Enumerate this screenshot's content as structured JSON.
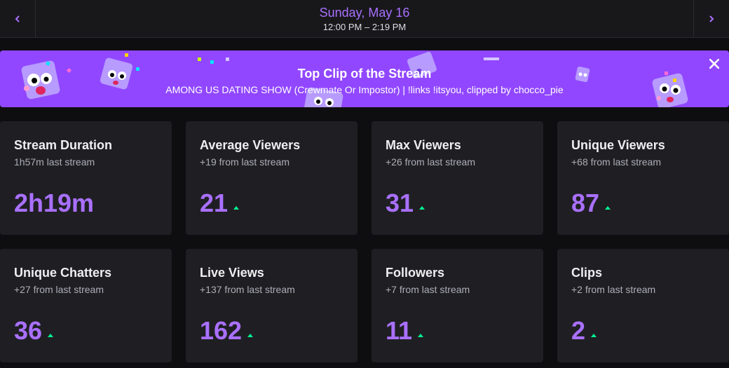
{
  "header": {
    "date": "Sunday, May 16",
    "time_range": "12:00 PM – 2:19 PM",
    "prev_icon": "chevron-left-icon",
    "next_icon": "chevron-right-icon"
  },
  "banner": {
    "title": "Top Clip of the Stream",
    "subtitle": "AMONG US DATING SHOW (Crewmate Or Impostor) | !links !itsyou, clipped by chocco_pie",
    "close_icon": "close-icon",
    "background": "#9147ff"
  },
  "colors": {
    "accent": "#a970ff",
    "increase": "#00f593",
    "card_bg": "#1f1f23"
  },
  "stats": [
    {
      "title": "Stream Duration",
      "sub": "1h57m last stream",
      "value": "2h19m",
      "trend": "none"
    },
    {
      "title": "Average Viewers",
      "sub": "+19 from last stream",
      "value": "21",
      "trend": "up"
    },
    {
      "title": "Max Viewers",
      "sub": "+26 from last stream",
      "value": "31",
      "trend": "up"
    },
    {
      "title": "Unique Viewers",
      "sub": "+68 from last stream",
      "value": "87",
      "trend": "up"
    },
    {
      "title": "Unique Chatters",
      "sub": "+27 from last stream",
      "value": "36",
      "trend": "up"
    },
    {
      "title": "Live Views",
      "sub": "+137 from last stream",
      "value": "162",
      "trend": "up"
    },
    {
      "title": "Followers",
      "sub": "+7 from last stream",
      "value": "11",
      "trend": "up"
    },
    {
      "title": "Clips",
      "sub": "+2 from last stream",
      "value": "2",
      "trend": "up"
    }
  ]
}
